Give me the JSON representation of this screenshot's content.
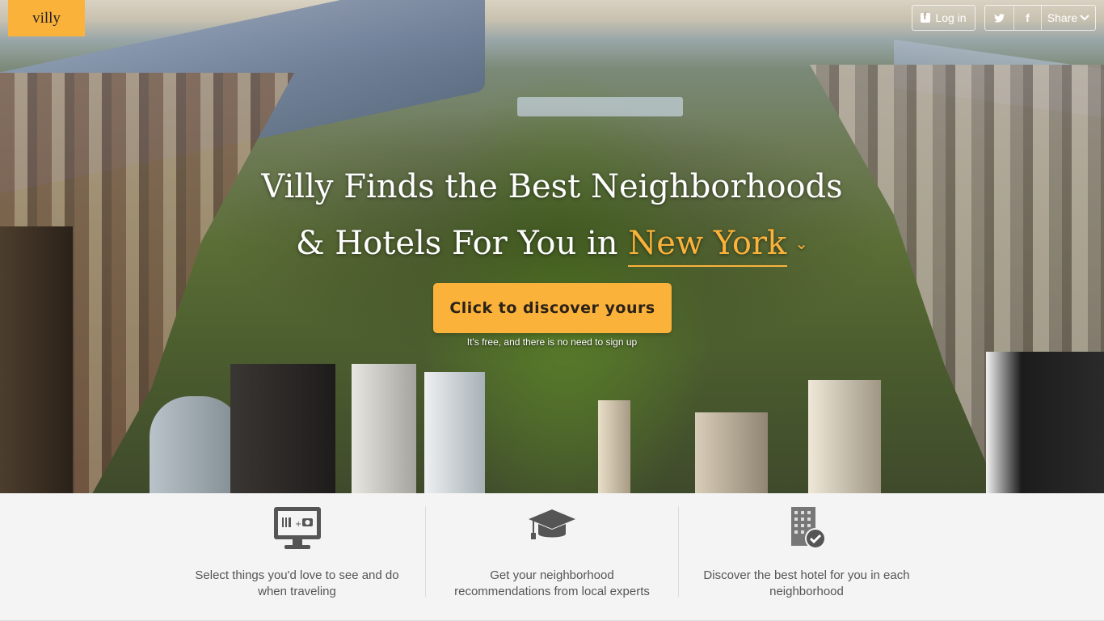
{
  "brand": {
    "logo_text": "villy",
    "accent_color": "#fbb23a"
  },
  "header": {
    "login_label": "Log in",
    "share_label": "Share",
    "twitter_icon": "twitter-icon",
    "facebook_icon": "facebook-icon"
  },
  "hero": {
    "headline_line1": "Villy Finds the Best Neighborhoods",
    "headline_line2": "& Hotels For You in",
    "city": "New York",
    "cta_label": "Click to discover yours",
    "cta_note": "It's free, and there is no need to sign up"
  },
  "features": [
    {
      "icon": "monitor-icon",
      "text": "Select things you'd love to see and do when traveling"
    },
    {
      "icon": "graduation-cap-icon",
      "text": "Get your neighborhood recommendations from local experts"
    },
    {
      "icon": "hotel-check-icon",
      "text": "Discover the best hotel for you in each neighborhood"
    }
  ]
}
